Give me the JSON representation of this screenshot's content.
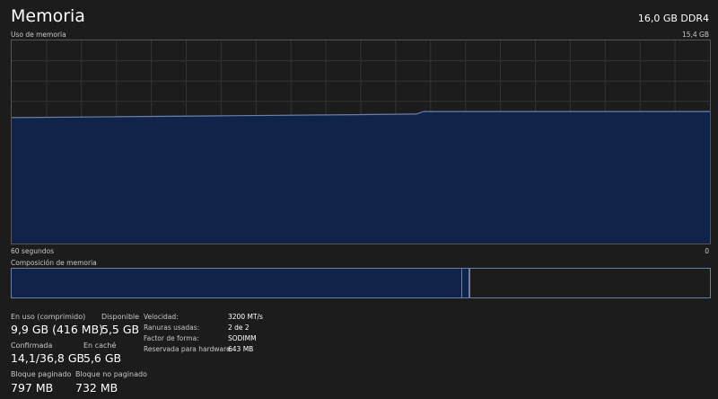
{
  "header": {
    "title": "Memoria",
    "total_memory": "16,0 GB DDR4"
  },
  "usage_graph": {
    "label": "Uso de memoria",
    "max_label": "15,4 GB",
    "time_label": "60 segundos",
    "end_label": "0",
    "line_color": "#6a7fa8",
    "fill_color": "#10244a",
    "usage_fraction_start": 0.62,
    "usage_fraction_end": 0.65
  },
  "composition": {
    "label": "Composición de memoria",
    "in_use_fraction": 0.644,
    "modified_fraction": 0.012,
    "standby_fraction": 0.344
  },
  "stats": {
    "in_use_label": "En uso (comprimido)",
    "in_use_value": "9,9 GB (416 MB)",
    "available_label": "Disponible",
    "available_value": "5,5 GB",
    "committed_label": "Confirmada",
    "committed_value": "14,1/36,8 GB",
    "cached_label": "En caché",
    "cached_value": "5,6 GB",
    "paged_pool_label": "Bloque paginado",
    "paged_pool_value": "797 MB",
    "nonpaged_pool_label": "Bloque no paginado",
    "nonpaged_pool_value": "732 MB"
  },
  "specs": {
    "speed_label": "Velocidad:",
    "speed_value": "3200 MT/s",
    "slots_label": "Ranuras usadas:",
    "slots_value": "2 de 2",
    "form_factor_label": "Factor de forma:",
    "form_factor_value": "SODIMM",
    "reserved_label": "Reservada para hardware:",
    "reserved_value": "643 MB"
  }
}
